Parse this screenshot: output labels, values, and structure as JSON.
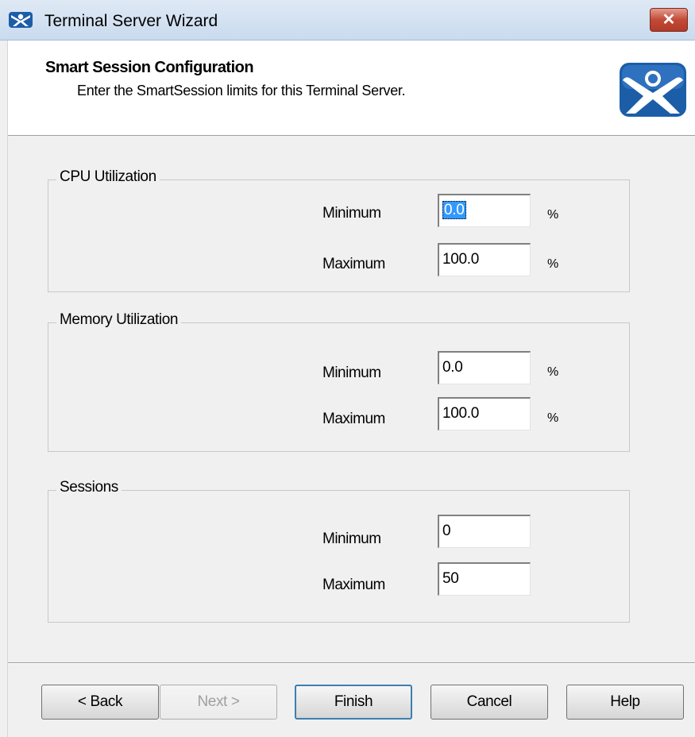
{
  "window": {
    "title": "Terminal Server Wizard",
    "close_label": "✕"
  },
  "header": {
    "title": "Smart Session Configuration",
    "subtitle": "Enter the  SmartSession limits for this Terminal Server."
  },
  "groups": {
    "cpu": {
      "title": "CPU Utilization",
      "min_label": "Minimum",
      "max_label": "Maximum",
      "min_value": "0.0",
      "max_value": "100.0",
      "unit": "%"
    },
    "memory": {
      "title": "Memory Utilization",
      "min_label": "Minimum",
      "max_label": "Maximum",
      "min_value": "0.0",
      "max_value": "100.0",
      "unit": "%"
    },
    "sessions": {
      "title": "Sessions",
      "min_label": "Minimum",
      "max_label": "Maximum",
      "min_value": "0",
      "max_value": "50"
    }
  },
  "buttons": {
    "back": "< Back",
    "next": "Next >",
    "finish": "Finish",
    "cancel": "Cancel",
    "help": "Help"
  },
  "icons": {
    "app": "thinmanager-icon",
    "logo": "thinmanager-logo"
  },
  "colors": {
    "logo_blue": "#1c5da8",
    "selection": "#3399ff",
    "close_red": "#c24a36"
  }
}
